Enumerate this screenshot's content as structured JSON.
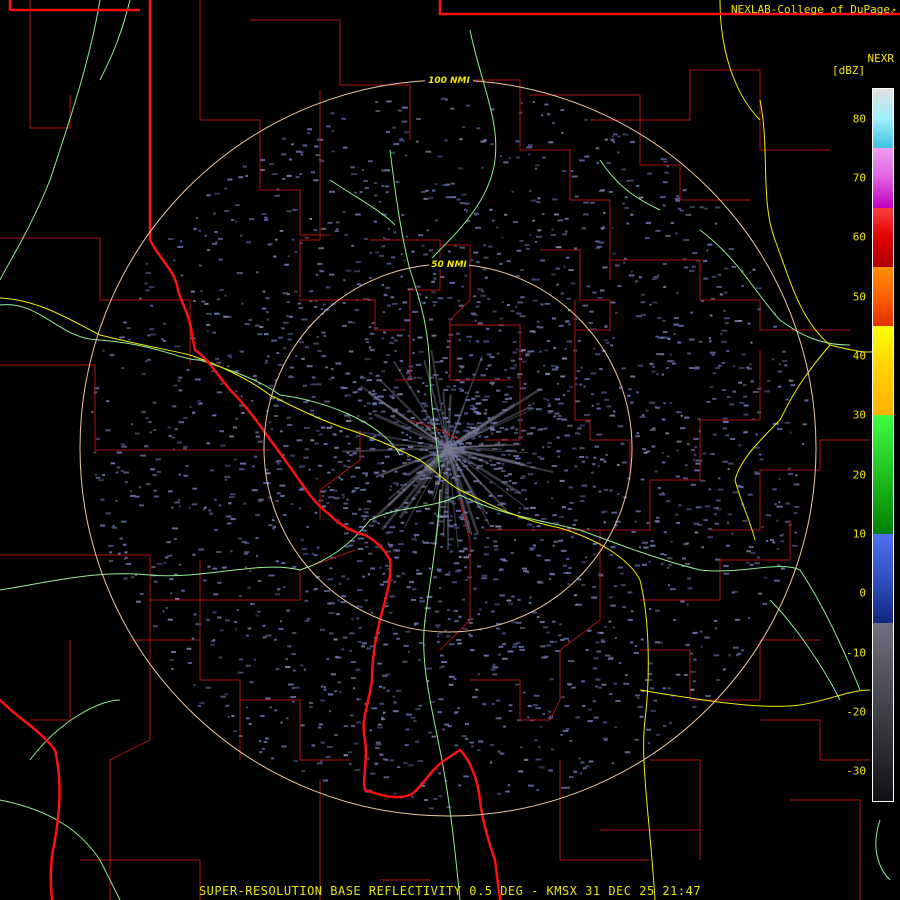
{
  "header": {
    "credit": "NEXLAB-College of DuPage",
    "credit_icon": "external-link-icon",
    "product": "NEXR",
    "units": "[dBZ]"
  },
  "range_rings": [
    {
      "label": "100 NMI"
    },
    {
      "label": "50 NMI"
    }
  ],
  "colorbar": {
    "ticks": [
      {
        "label": "80",
        "value": 80
      },
      {
        "label": "70",
        "value": 70
      },
      {
        "label": "60",
        "value": 60
      },
      {
        "label": "50",
        "value": 50
      },
      {
        "label": "40",
        "value": 40
      },
      {
        "label": "30",
        "value": 30
      },
      {
        "label": "20",
        "value": 20
      },
      {
        "label": "10",
        "value": 10
      },
      {
        "label": "0",
        "value": 0
      },
      {
        "label": "-10",
        "value": -10
      },
      {
        "label": "-20",
        "value": -20
      },
      {
        "label": "-30",
        "value": -30
      }
    ],
    "range": [
      -35,
      85
    ],
    "bands": [
      {
        "from": 75,
        "to": 85,
        "colors": [
          "#e0e0e0",
          "#a0f0ff",
          "#40c0e0"
        ]
      },
      {
        "from": 65,
        "to": 75,
        "colors": [
          "#f0a0f0",
          "#e060e0",
          "#c000c0"
        ]
      },
      {
        "from": 55,
        "to": 65,
        "colors": [
          "#ff4040",
          "#e00000",
          "#b00000"
        ]
      },
      {
        "from": 45,
        "to": 55,
        "colors": [
          "#ff9000",
          "#ff6000",
          "#e03000"
        ]
      },
      {
        "from": 30,
        "to": 45,
        "colors": [
          "#ffff00",
          "#ffd000",
          "#ffb000"
        ]
      },
      {
        "from": 10,
        "to": 30,
        "colors": [
          "#40ff40",
          "#20c020",
          "#008000"
        ]
      },
      {
        "from": -5,
        "to": 10,
        "colors": [
          "#5070f0",
          "#3050c0",
          "#102880"
        ]
      },
      {
        "from": -35,
        "to": -5,
        "colors": [
          "#707080",
          "#404048",
          "#101014"
        ]
      }
    ]
  },
  "colors": {
    "state_border": "#ff1010",
    "county_border": "#b01010",
    "river": "#90f090",
    "highway": "#f0f000",
    "range_ring": "#f0c8a0",
    "echo": "#6b74b8"
  },
  "footer": "SUPER-RESOLUTION BASE REFLECTIVITY 0.5 DEG - KMSX 31 DEC 25 21:47"
}
